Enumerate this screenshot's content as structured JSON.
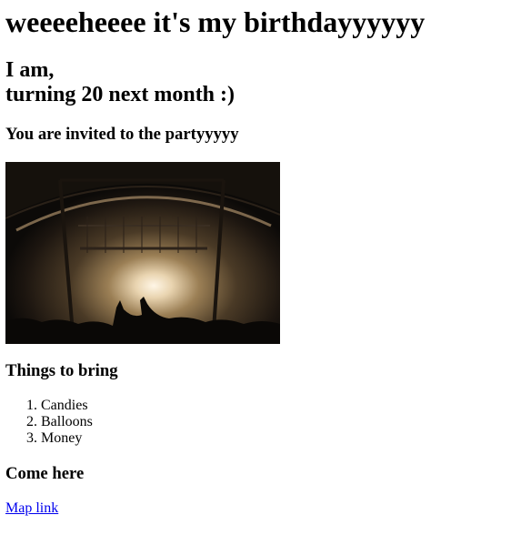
{
  "header": {
    "title": "weeeeheeee it's my birthdayyyyyy"
  },
  "intro": {
    "line1": "I am,",
    "line2": "turning 20 next month :)"
  },
  "invite": {
    "text": "You are invited to the partyyyyy"
  },
  "bring": {
    "heading": "Things to bring",
    "items": [
      "Candies",
      "Balloons",
      "Money"
    ]
  },
  "location": {
    "heading": "Come here",
    "link_label": "Map link"
  },
  "colors": {
    "link": "#0000ee"
  }
}
